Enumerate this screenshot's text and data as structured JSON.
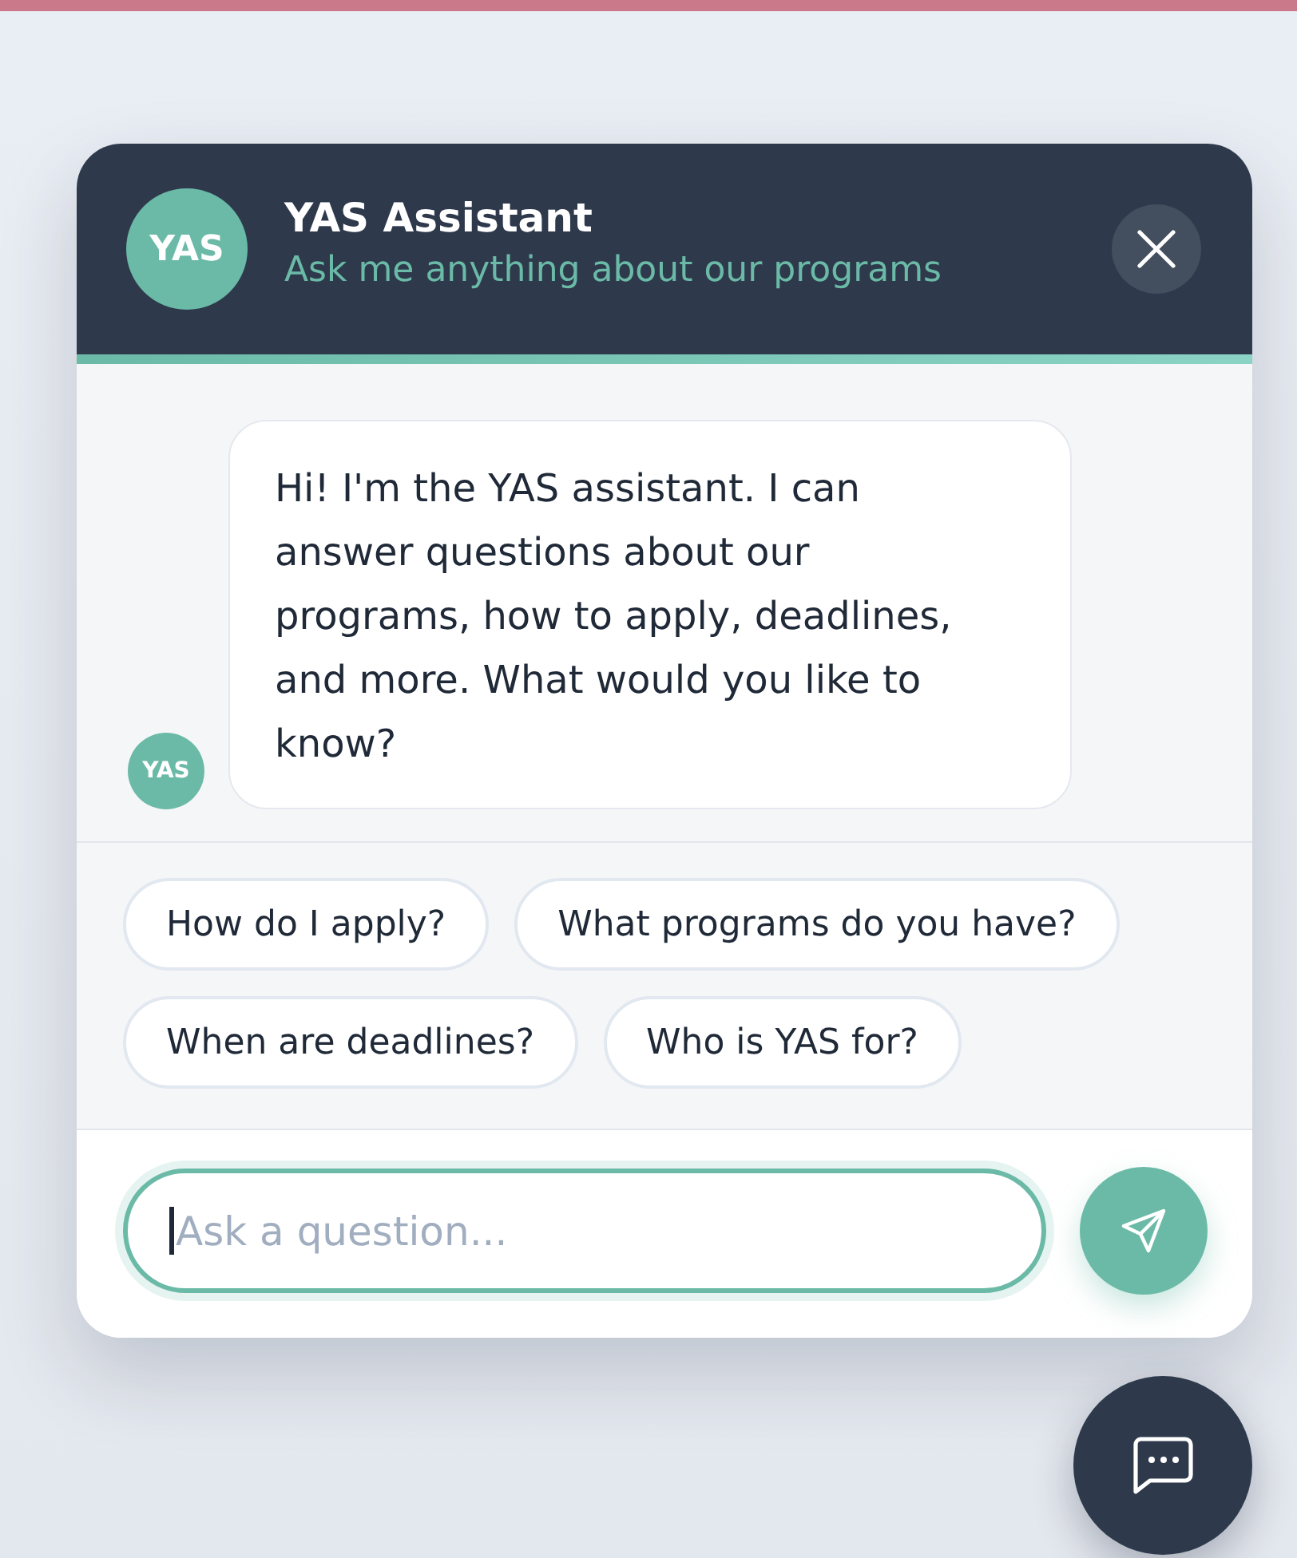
{
  "chat_window": {
    "header": {
      "avatar": "YAS",
      "title": "YAS Assistant",
      "subtitle": "Ask me anything about our programs"
    },
    "messages": [
      {
        "kind": "bot",
        "avatar": "YAS",
        "text": "Hi! I'm the YAS assistant. I can answer questions about our programs, how to apply, deadlines, and more. What would you like to know?"
      }
    ],
    "suggestions": [
      "How do I apply?",
      "What programs do you have?",
      "When are deadlines?",
      "Who is YAS for?"
    ],
    "input": {
      "placeholder": "Ask a question...",
      "focused": true
    }
  }
}
